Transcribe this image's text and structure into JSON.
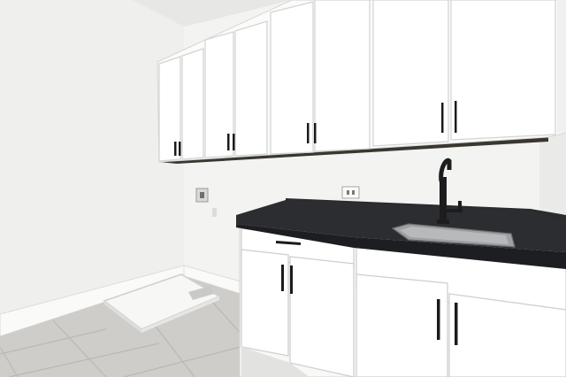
{
  "scene": {
    "subject": "laundry-room",
    "colors": {
      "wall": "#f1f1ef",
      "wall_shadow": "#e4e4e2",
      "ceiling": "#e6e6e4",
      "cabinet": "#ffffff",
      "cabinet_edge": "#d9d9d7",
      "countertop": "#26272b",
      "handle": "#1b1b1d",
      "floor_tile": "#cfcdc9",
      "grout": "#b9b7b3",
      "sink": "#a8a9ab",
      "baseboard": "#fbfbfa"
    },
    "icons": [
      "faucet-icon",
      "electrical-outlet-icon",
      "dryer-vent-icon",
      "washer-drain-pan-icon"
    ]
  }
}
